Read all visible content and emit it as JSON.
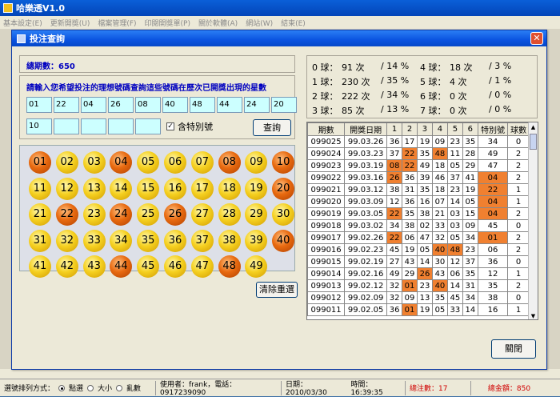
{
  "app": {
    "title": "哈樂透V1.0",
    "menu": [
      "基本設定(E)",
      "更新開獎(U)",
      "檔案管理(F)",
      "印閱開獎單(P)",
      "關於軟體(A)",
      "網站(W)",
      "結束(E)"
    ]
  },
  "dialog": {
    "title": "投注查詢",
    "total_label": "總期數：650",
    "prompt": "請輸入您希望投注的理想號碼查詢這些號碼在歷次已開獎出現的星數",
    "inputs": [
      "01",
      "22",
      "04",
      "26",
      "08",
      "40",
      "48",
      "44",
      "24",
      "20",
      "10",
      "",
      "",
      "",
      ""
    ],
    "special_checkbox": "含特別號",
    "query_button": "查詢",
    "clear_button": "清除重選",
    "close_button": "關閉"
  },
  "stats": [
    {
      "label": "0 球：",
      "count": "91 次",
      "pct": "/ 14 %"
    },
    {
      "label": "4 球：",
      "count": "18 次",
      "pct": "/ 3 %"
    },
    {
      "label": "1 球：",
      "count": "230 次",
      "pct": "/ 35 %"
    },
    {
      "label": "5 球：",
      "count": "4 次",
      "pct": "/ 1 %"
    },
    {
      "label": "2 球：",
      "count": "222 次",
      "pct": "/ 34 %"
    },
    {
      "label": "6 球：",
      "count": "0 次",
      "pct": "/ 0 %"
    },
    {
      "label": "3 球：",
      "count": "85 次",
      "pct": "/ 13 %"
    },
    {
      "label": "7 球：",
      "count": "0 次",
      "pct": "/ 0 %"
    }
  ],
  "balls": {
    "numbers": [
      "01",
      "02",
      "03",
      "04",
      "05",
      "06",
      "07",
      "08",
      "09",
      "10",
      "11",
      "12",
      "13",
      "14",
      "15",
      "16",
      "17",
      "18",
      "19",
      "20",
      "21",
      "22",
      "23",
      "24",
      "25",
      "26",
      "27",
      "28",
      "29",
      "30",
      "31",
      "32",
      "33",
      "34",
      "35",
      "36",
      "37",
      "38",
      "39",
      "40",
      "41",
      "42",
      "43",
      "44",
      "45",
      "46",
      "47",
      "48",
      "49"
    ],
    "red": [
      "01",
      "04",
      "08",
      "10",
      "20",
      "22",
      "24",
      "26",
      "40",
      "44",
      "48"
    ]
  },
  "table": {
    "headers": [
      "期數",
      "開獎日期",
      "1",
      "2",
      "3",
      "4",
      "5",
      "6",
      "特別號",
      "球數"
    ],
    "rows": [
      [
        "099025",
        "99.03.26",
        "36",
        "17",
        "19",
        "09",
        "23",
        "35",
        "34",
        "0"
      ],
      [
        "099024",
        "99.03.23",
        "37",
        "22",
        "35",
        "48",
        "11",
        "28",
        "49",
        "2"
      ],
      [
        "099023",
        "99.03.19",
        "08",
        "22",
        "49",
        "18",
        "05",
        "29",
        "47",
        "2"
      ],
      [
        "099022",
        "99.03.16",
        "26",
        "36",
        "39",
        "46",
        "37",
        "41",
        "04",
        "2"
      ],
      [
        "099021",
        "99.03.12",
        "38",
        "31",
        "35",
        "18",
        "23",
        "19",
        "22",
        "1"
      ],
      [
        "099020",
        "99.03.09",
        "12",
        "36",
        "16",
        "07",
        "14",
        "05",
        "04",
        "1"
      ],
      [
        "099019",
        "99.03.05",
        "22",
        "35",
        "38",
        "21",
        "03",
        "15",
        "04",
        "2"
      ],
      [
        "099018",
        "99.03.02",
        "34",
        "38",
        "02",
        "33",
        "03",
        "09",
        "45",
        "0"
      ],
      [
        "099017",
        "99.02.26",
        "22",
        "06",
        "47",
        "32",
        "05",
        "34",
        "01",
        "2"
      ],
      [
        "099016",
        "99.02.23",
        "45",
        "19",
        "05",
        "40",
        "48",
        "23",
        "06",
        "2"
      ],
      [
        "099015",
        "99.02.19",
        "27",
        "43",
        "14",
        "30",
        "12",
        "37",
        "36",
        "0"
      ],
      [
        "099014",
        "99.02.16",
        "49",
        "29",
        "26",
        "43",
        "06",
        "35",
        "12",
        "1"
      ],
      [
        "099013",
        "99.02.12",
        "32",
        "01",
        "23",
        "40",
        "14",
        "31",
        "35",
        "2"
      ],
      [
        "099012",
        "99.02.09",
        "32",
        "09",
        "13",
        "35",
        "45",
        "34",
        "38",
        "0"
      ],
      [
        "099011",
        "99.02.05",
        "36",
        "01",
        "19",
        "05",
        "33",
        "14",
        "16",
        "1"
      ]
    ],
    "highlights": [
      [
        1,
        3
      ],
      [
        1,
        5
      ],
      [
        2,
        2
      ],
      [
        2,
        3
      ],
      [
        3,
        2
      ],
      [
        3,
        8
      ],
      [
        4,
        8
      ],
      [
        5,
        8
      ],
      [
        6,
        2
      ],
      [
        6,
        8
      ],
      [
        8,
        2
      ],
      [
        8,
        8
      ],
      [
        9,
        5
      ],
      [
        9,
        6
      ],
      [
        11,
        4
      ],
      [
        12,
        3
      ],
      [
        12,
        5
      ],
      [
        14,
        3
      ]
    ]
  },
  "status": {
    "sort_label": "選號排列方式：",
    "opt1": "點選",
    "opt2": "大小",
    "opt3": "亂數",
    "user": "使用者：frank，電話：0917239090",
    "date": "日期：2010/03/30",
    "time": "時間：16:39:35",
    "bets": "總注數：17",
    "amount": "總金額：850"
  }
}
